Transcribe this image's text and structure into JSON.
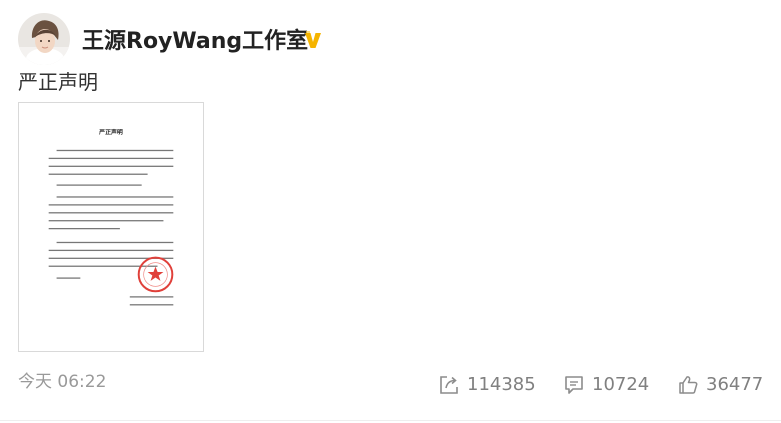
{
  "post": {
    "author": "王源RoyWang工作室",
    "text": "严正声明",
    "time": "今天 06:22"
  },
  "document_image": {
    "title": "严正声明"
  },
  "actions": {
    "forward_count": "114385",
    "comment_count": "10724",
    "like_count": "36477"
  },
  "icons": {
    "verified": "verified-badge-icon",
    "forward": "forward-icon",
    "comment": "comment-icon",
    "like": "like-icon"
  },
  "colors": {
    "verified_badge": "#f5b400",
    "icon_gray": "#8c8c8c",
    "stamp_red": "#e0403a"
  }
}
